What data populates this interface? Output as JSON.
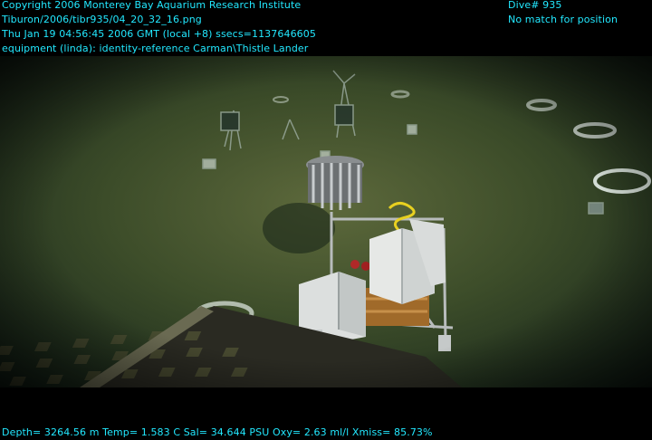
{
  "overlay": {
    "copyright": "Copyright 2006 Monterey Bay Aquarium Research Institute",
    "file_path": "Tiburon/2006/tibr935/04_20_32_16.png",
    "timestamp": "Thu Jan 19 04:56:45 2006 GMT (local +8)  ssecs=1137646605",
    "equipment": "equipment (linda): identity-reference Carman\\Thistle Lander",
    "dive": "Dive# 935",
    "position_status": "No match for position",
    "telemetry": "Depth= 3264.56 m  Temp= 1.583 C  Sal= 34.644 PSU  Oxy= 2.63 ml/l  Xmiss= 85.73%"
  },
  "colors": {
    "overlay_text": "#22e8ff",
    "water": "#0b2a26",
    "seafloor": "#3a4a22"
  },
  "scene_objects": [
    "lander-frame",
    "instrument-housing",
    "sampling-carousel",
    "rov-skid-grate",
    "seafloor-rings",
    "tripod-markers"
  ]
}
